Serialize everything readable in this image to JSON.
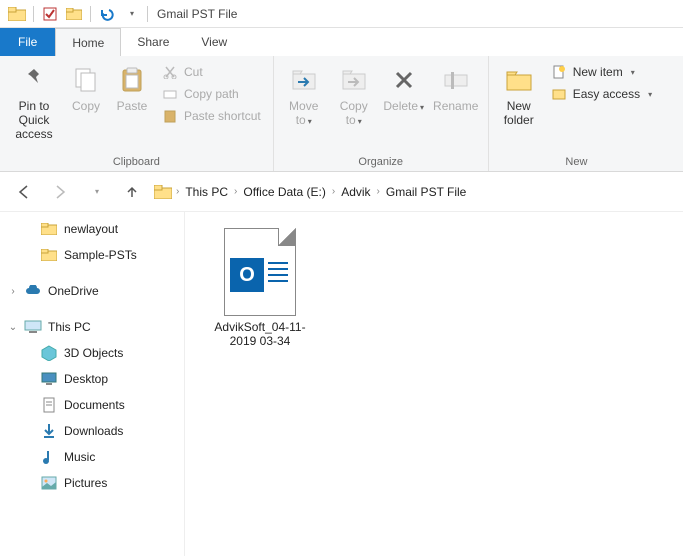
{
  "window": {
    "title": "Gmail PST File"
  },
  "tabs": {
    "file": "File",
    "home": "Home",
    "share": "Share",
    "view": "View"
  },
  "ribbon": {
    "pin": "Pin to Quick access",
    "copy": "Copy",
    "paste": "Paste",
    "cut": "Cut",
    "copypath": "Copy path",
    "pasteshortcut": "Paste shortcut",
    "clipboard_label": "Clipboard",
    "moveto": "Move to",
    "copyto": "Copy to",
    "delete": "Delete",
    "rename": "Rename",
    "organize_label": "Organize",
    "newfolder": "New folder",
    "newitem": "New item",
    "easyaccess": "Easy access",
    "new_label": "New"
  },
  "breadcrumb": [
    "This PC",
    "Office Data (E:)",
    "Advik",
    "Gmail PST File"
  ],
  "tree": {
    "newlayout": "newlayout",
    "samplepsts": "Sample-PSTs",
    "onedrive": "OneDrive",
    "thispc": "This PC",
    "objects3d": "3D Objects",
    "desktop": "Desktop",
    "documents": "Documents",
    "downloads": "Downloads",
    "music": "Music",
    "pictures": "Pictures"
  },
  "file": {
    "name": "AdvikSoft_04-11-2019 03-34"
  }
}
